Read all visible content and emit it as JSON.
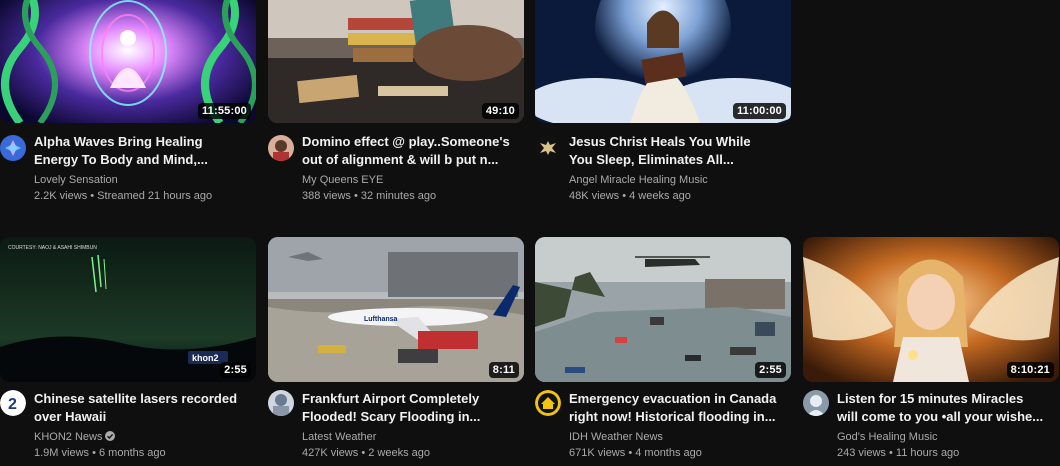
{
  "videos": [
    {
      "title_line1": "Alpha Waves Bring Healing",
      "title_line2": "Energy To Body and Mind,...",
      "channel": "Lovely Sensation",
      "views": "2.2K views",
      "age": "Streamed 21 hours ago",
      "duration": "11:55:00"
    },
    {
      "title_line1": "Domino effect @ play..Someone's",
      "title_line2": "out of alignment & will b put n...",
      "channel": "My Queens EYE",
      "views": "388 views",
      "age": "32 minutes ago",
      "duration": "49:10"
    },
    {
      "title_line1": "Jesus Christ Heals You While",
      "title_line2": "You Sleep, Eliminates All...",
      "channel": "Angel Miracle Healing Music",
      "views": "48K views",
      "age": "4 weeks ago",
      "duration": "11:00:00"
    },
    {
      "title_line1": "Chinese satellite lasers recorded",
      "title_line2": "over Hawaii",
      "channel": "KHON2 News",
      "views": "1.9M views",
      "age": "6 months ago",
      "duration": "2:55",
      "thumb_caption": "COURTESY: NAOJ & ASAHI SHIMBUN",
      "thumb_logo": "khon2"
    },
    {
      "title_line1": "Frankfurt Airport Completely",
      "title_line2": "Flooded! Scary Flooding in...",
      "channel": "Latest Weather",
      "views": "427K views",
      "age": "2 weeks ago",
      "duration": "8:11",
      "thumb_plane_text": "Lufthansa"
    },
    {
      "title_line1": "Emergency evacuation in Canada",
      "title_line2": "right now! Historical flooding in...",
      "channel": "IDH Weather News",
      "views": "671K views",
      "age": "4 months ago",
      "duration": "2:55"
    },
    {
      "title_line1": "Listen for 15 minutes Miracles",
      "title_line2": "will come to you •all your wishe...",
      "channel": "God's Healing Music",
      "views": "243 views",
      "age": "11 hours ago",
      "duration": "8:10:21"
    }
  ],
  "icons": {
    "verified": "verified-check-icon"
  },
  "colors": {
    "background": "#0f0f0f",
    "title": "#f1f1f1",
    "meta": "#aaaaaa",
    "duration_bg": "#000000"
  }
}
